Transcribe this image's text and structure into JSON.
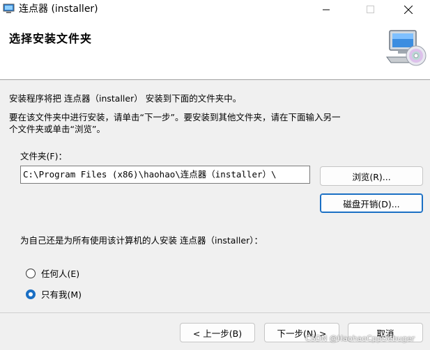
{
  "window": {
    "title": "连点器 (installer)",
    "icons": {
      "app": "computer-icon",
      "minimize": "minimize-icon",
      "maximize": "maximize-icon",
      "close": "close-icon"
    }
  },
  "header": {
    "title": "选择安装文件夹",
    "icon": "computer-disc-icon"
  },
  "body": {
    "intro": "安装程序将把 连点器（installer） 安装到下面的文件夹中。",
    "instructions_line1": "要在该文件夹中进行安装，请单击“下一步”。要安装到其他文件夹，请在下面输入另一",
    "instructions_line2": "个文件夹或单击“浏览”。",
    "folder_label": "文件夹(F)：",
    "folder_path": "C:\\Program Files (x86)\\haohao\\连点器（installer）\\",
    "browse_button": "浏览(R)...",
    "disk_cost_button": "磁盘开销(D)...",
    "scope_label": "为自己还是为所有使用该计算机的人安装 连点器（installer）：",
    "options": [
      {
        "label": "任何人(E)",
        "selected": false
      },
      {
        "label": "只有我(M)",
        "selected": true
      }
    ]
  },
  "footer": {
    "back_button": "< 上一步(B)",
    "next_button": "下一步(N) >",
    "cancel_button": "取消"
  },
  "watermark": "CSDN @HaohaoCppDebuger",
  "colors": {
    "accent": "#1a6fc4",
    "background": "#f0f0f0",
    "banner": "#ffffff"
  }
}
